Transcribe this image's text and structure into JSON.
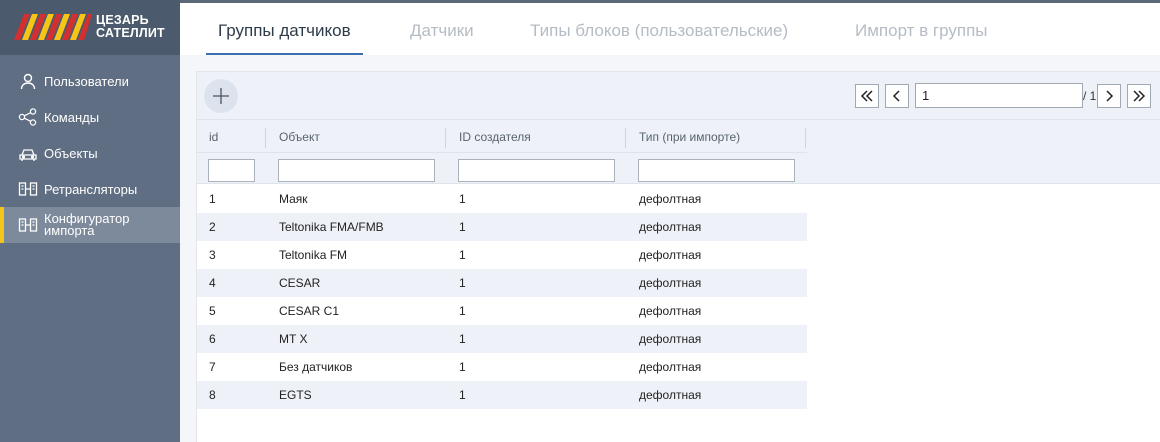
{
  "brand": {
    "line1": "ЦЕЗАРЬ",
    "line2": "САТЕЛЛИТ"
  },
  "colors": {
    "sidebar": "#5f6e82",
    "accent": "#f5c518",
    "logo_stripe_red": "#d32f2f",
    "logo_stripe_yellow": "#f5c518",
    "tab_active_border": "#3a6fb0"
  },
  "sidebar": {
    "items": [
      {
        "label": "Пользователи",
        "icon": "user-icon"
      },
      {
        "label": "Команды",
        "icon": "share-icon"
      },
      {
        "label": "Объекты",
        "icon": "car-icon"
      },
      {
        "label": "Ретрансляторы",
        "icon": "relay-icon"
      },
      {
        "label_line1": "Конфигуратор",
        "label_line2": "импорта",
        "icon": "relay-icon",
        "active": true
      }
    ]
  },
  "tabs": [
    {
      "label": "Группы датчиков",
      "active": true
    },
    {
      "label": "Датчики"
    },
    {
      "label": "Типы блоков (пользовательские)"
    },
    {
      "label": "Импорт в группы"
    }
  ],
  "pager": {
    "current": "1",
    "total": "/ 1"
  },
  "table": {
    "columns": [
      "id",
      "Объект",
      "ID создателя",
      "Тип (при импорте)"
    ],
    "rows": [
      [
        "1",
        "Маяк",
        "1",
        "дефолтная"
      ],
      [
        "2",
        "Teltonika FMA/FMB",
        "1",
        "дефолтная"
      ],
      [
        "3",
        "Teltonika FM",
        "1",
        "дефолтная"
      ],
      [
        "4",
        "CESAR",
        "1",
        "дефолтная"
      ],
      [
        "5",
        "CESAR C1",
        "1",
        "дефолтная"
      ],
      [
        "6",
        "MT X",
        "1",
        "дефолтная"
      ],
      [
        "7",
        "Без датчиков",
        "1",
        "дефолтная"
      ],
      [
        "8",
        "EGTS",
        "1",
        "дефолтная"
      ]
    ]
  }
}
